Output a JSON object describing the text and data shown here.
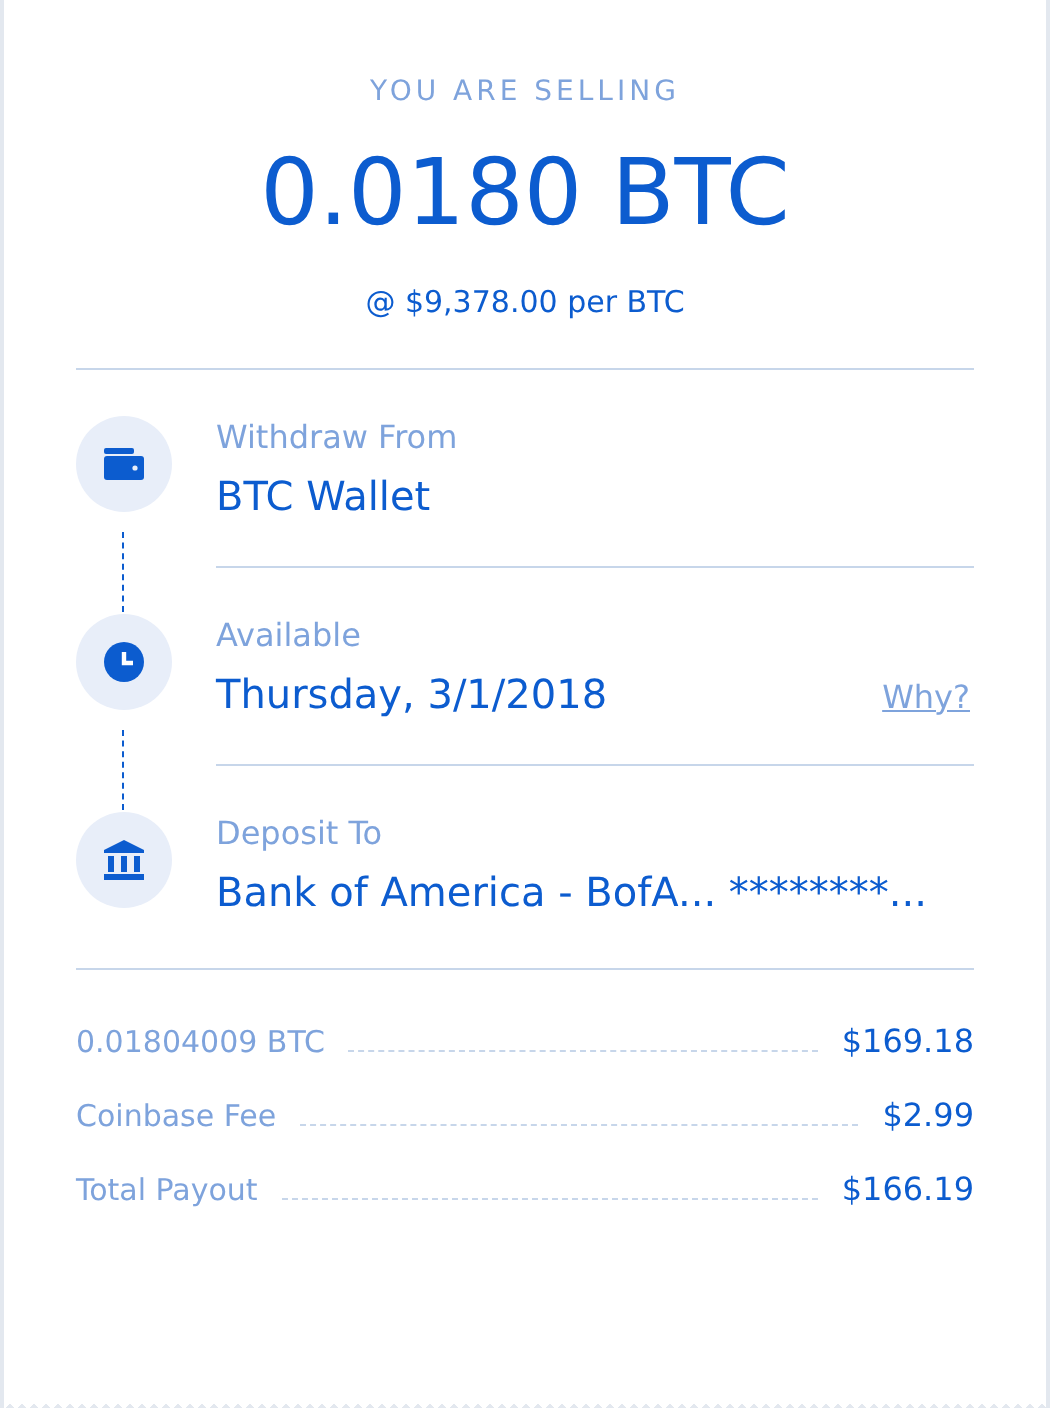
{
  "header": {
    "caption": "YOU ARE SELLING",
    "amount": "0.0180 BTC",
    "rate": "@ $9,378.00 per BTC"
  },
  "steps": [
    {
      "kind": "wallet",
      "label": "Withdraw From",
      "value": "BTC Wallet"
    },
    {
      "kind": "clock",
      "label": "Available",
      "value": "Thursday, 3/1/2018",
      "link": "Why?"
    },
    {
      "kind": "bank",
      "label": "Deposit To",
      "value": "Bank of America - BofA... ********..."
    }
  ],
  "summary": [
    {
      "label": "0.01804009 BTC",
      "value": "$169.18"
    },
    {
      "label": "Coinbase Fee",
      "value": "$2.99"
    },
    {
      "label": "Total Payout",
      "value": "$166.19"
    }
  ]
}
